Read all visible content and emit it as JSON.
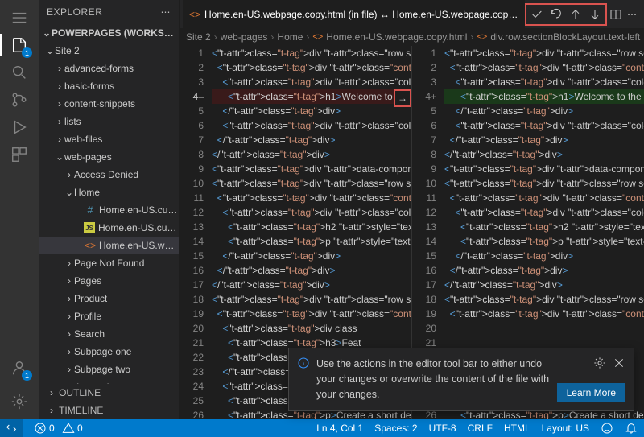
{
  "sidebar": {
    "title": "EXPLORER",
    "workspace": "POWERPAGES (WORKSPA…",
    "tree": [
      {
        "label": "Site 2",
        "depth": 0,
        "exp": true
      },
      {
        "label": "advanced-forms",
        "depth": 1
      },
      {
        "label": "basic-forms",
        "depth": 1
      },
      {
        "label": "content-snippets",
        "depth": 1
      },
      {
        "label": "lists",
        "depth": 1
      },
      {
        "label": "web-files",
        "depth": 1
      },
      {
        "label": "web-pages",
        "depth": 1,
        "exp": true
      },
      {
        "label": "Access Denied",
        "depth": 2
      },
      {
        "label": "Home",
        "depth": 2,
        "exp": true
      },
      {
        "label": "Home.en-US.cust…",
        "depth": 3,
        "ico": "hash",
        "file": true
      },
      {
        "label": "Home.en-US.cust…",
        "depth": 3,
        "ico": "js",
        "file": true
      },
      {
        "label": "Home.en-US.web…",
        "depth": 3,
        "ico": "ht",
        "file": true,
        "sel": true
      },
      {
        "label": "Page Not Found",
        "depth": 2
      },
      {
        "label": "Pages",
        "depth": 2
      },
      {
        "label": "Product",
        "depth": 2
      },
      {
        "label": "Profile",
        "depth": 2
      },
      {
        "label": "Search",
        "depth": 2
      },
      {
        "label": "Subpage one",
        "depth": 2
      },
      {
        "label": "Subpage two",
        "depth": 2
      },
      {
        "label": "web-templates",
        "depth": 1
      }
    ],
    "outline": "OUTLINE",
    "timeline": "TIMELINE"
  },
  "tab": {
    "label": "Home.en-US.webpage.copy.html (in file) ↔ Home.en-US.webpage.copy…"
  },
  "breadcrumbs": [
    "Site 2",
    "web-pages",
    "Home",
    "Home.en-US.webpage.copy.html",
    "div.row.sectionBlockLayout.text-left"
  ],
  "codeL": [
    {
      "n": 1,
      "h": "<div class=\"row sectionBlockLayout"
    },
    {
      "n": 2,
      "h": "  <div class=\"container\" style=\"pa"
    },
    {
      "n": 3,
      "h": "    <div class=\"col-md-6 columnBlo"
    },
    {
      "n": "4‒",
      "h": "      <h1>Welcome to the new websi",
      "cls": "del",
      "cur": true
    },
    {
      "n": 5,
      "h": "    </div>"
    },
    {
      "n": 6,
      "h": "    <div class=\"col-md-6 columnBlo"
    },
    {
      "n": 7,
      "h": "  </div>"
    },
    {
      "n": 8,
      "h": "</div>"
    },
    {
      "n": 9,
      "h": "<div data-component-theme=\"portalT"
    },
    {
      "n": 10,
      "h": "<div class=\"row sectionBlockLayout"
    },
    {
      "n": 11,
      "h": "  <div class=\"container\" style=\"pa"
    },
    {
      "n": 12,
      "h": "    <div class=\"col-md-12 columnBl"
    },
    {
      "n": 13,
      "h": "      <h2 style=\"text-align: cente"
    },
    {
      "n": 14,
      "h": "      <p style=\"text-align: center"
    },
    {
      "n": 15,
      "h": "    </div>"
    },
    {
      "n": 16,
      "h": "  </div>"
    },
    {
      "n": 17,
      "h": "</div>"
    },
    {
      "n": 18,
      "h": "<div class=\"row sectionBlockLayout"
    },
    {
      "n": 19,
      "h": "  <div class=\"container\" style=\"pa"
    },
    {
      "n": 20,
      "h": "    <div class"
    },
    {
      "n": 21,
      "h": "      <h3>Feat"
    },
    {
      "n": 22,
      "h": "      <p>Creat"
    },
    {
      "n": 23,
      "h": "    </div>"
    },
    {
      "n": 24,
      "h": "    <div class"
    },
    {
      "n": 25,
      "h": "      <h3>Feat"
    },
    {
      "n": 26,
      "h": "      <p>Create a short description"
    }
  ],
  "codeR": [
    {
      "n": 1,
      "h": "<div class=\"row sectionBlockLa"
    },
    {
      "n": 2,
      "h": "  <div class=\"container\" style"
    },
    {
      "n": 3,
      "h": "    <div class=\"col-md-6 colum"
    },
    {
      "n": "4+",
      "h": "      <h1>Welcome to the websi",
      "cls": "add"
    },
    {
      "n": 5,
      "h": "    </div>"
    },
    {
      "n": 6,
      "h": "    <div class=\"col-md-6 colum"
    },
    {
      "n": 7,
      "h": "  </div>"
    },
    {
      "n": 8,
      "h": "</div>"
    },
    {
      "n": 9,
      "h": "<div data-component-theme=\"por"
    },
    {
      "n": 10,
      "h": "<div class=\"row sectionBlockLa"
    },
    {
      "n": 11,
      "h": "  <div class=\"container\" style"
    },
    {
      "n": 12,
      "h": "    <div class=\"col-md-12 colu"
    },
    {
      "n": 13,
      "h": "      <h2 style=\"text-align: c"
    },
    {
      "n": 14,
      "h": "      <p style=\"text-align: ce"
    },
    {
      "n": 15,
      "h": "    </div>"
    },
    {
      "n": 16,
      "h": "  </div>"
    },
    {
      "n": 17,
      "h": "</div>"
    },
    {
      "n": 18,
      "h": "<div class=\"row sectionBlockLa"
    },
    {
      "n": 19,
      "h": "  <div class=\"container\" style"
    },
    {
      "n": 20,
      "h": ""
    },
    {
      "n": 21,
      "h": ""
    },
    {
      "n": 22,
      "h": ""
    },
    {
      "n": 23,
      "h": ""
    },
    {
      "n": 24,
      "h": ""
    },
    {
      "n": 25,
      "h": ""
    },
    {
      "n": 26,
      "h": "      <p>Create a short descri"
    }
  ],
  "notification": {
    "msg": "Use the actions in the editor tool bar to either undo your changes or overwrite the content of the file with your changes.",
    "learn": "Learn More"
  },
  "status": {
    "errors": "0",
    "warnings": "0",
    "pos": "Ln 4, Col 1",
    "spaces": "Spaces: 2",
    "enc": "UTF-8",
    "eol": "CRLF",
    "lang": "HTML",
    "layout": "Layout: US"
  }
}
